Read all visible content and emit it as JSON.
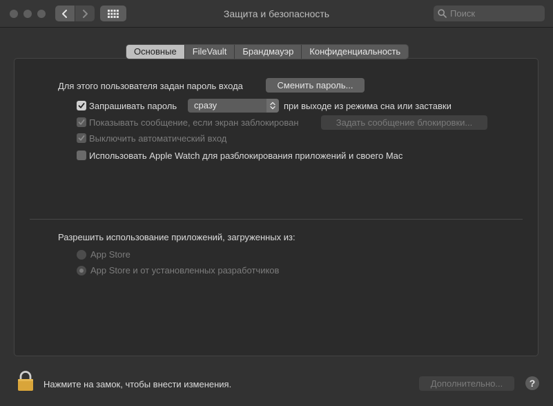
{
  "window": {
    "title": "Защита и безопасность",
    "search_placeholder": "Поиск"
  },
  "tabs": [
    {
      "label": "Основные",
      "active": true
    },
    {
      "label": "FileVault",
      "active": false
    },
    {
      "label": "Брандмауэр",
      "active": false
    },
    {
      "label": "Конфиденциальность",
      "active": false
    }
  ],
  "general": {
    "password_text": "Для этого пользователя задан пароль входа",
    "change_password_button": "Сменить пароль...",
    "require_password": {
      "label": "Запрашивать пароль",
      "checked": true
    },
    "require_select_value": "сразу",
    "require_suffix": "при выходе из режима сна или заставки",
    "show_message": {
      "label": "Показывать сообщение, если экран заблокирован",
      "checked": true,
      "disabled": true
    },
    "set_lock_message_button": "Задать сообщение блокировки...",
    "disable_autologin": {
      "label": "Выключить автоматический вход",
      "checked": true,
      "disabled": true
    },
    "apple_watch": {
      "label": "Использовать Apple Watch для разблокирования приложений и своего Mac",
      "checked": false
    }
  },
  "apps": {
    "heading": "Разрешить использование приложений, загруженных из:",
    "options": [
      {
        "label": "App Store",
        "selected": false
      },
      {
        "label": "App Store и от установленных разработчиков",
        "selected": true
      }
    ]
  },
  "footer": {
    "lock_text": "Нажмите на замок, чтобы внести изменения.",
    "advanced_button": "Дополнительно...",
    "help_label": "?"
  },
  "colors": {
    "background": "#323232",
    "panel": "#2b2b2b",
    "lock": "#d9a53a"
  },
  "icons": {
    "back": "chevron-left-icon",
    "forward": "chevron-right-icon",
    "grid": "grid-icon",
    "search": "search-icon",
    "lock": "lock-icon"
  }
}
